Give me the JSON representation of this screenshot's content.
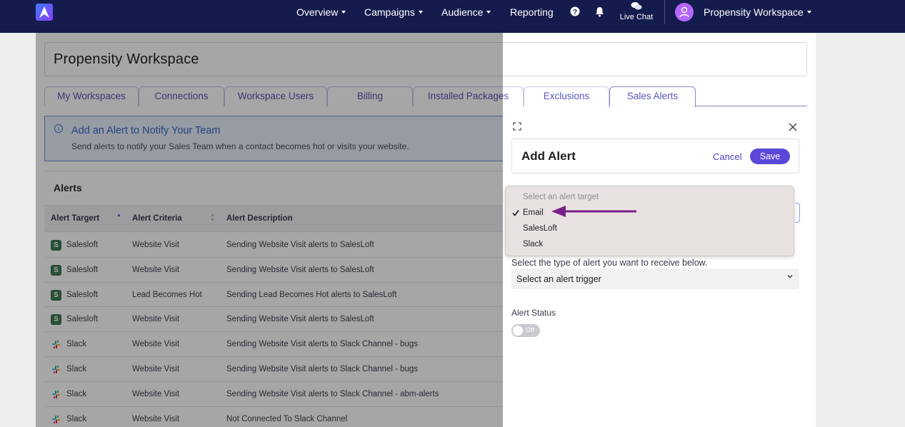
{
  "topnav": {
    "items": [
      {
        "label": "Overview"
      },
      {
        "label": "Campaigns"
      },
      {
        "label": "Audience"
      },
      {
        "label": "Reporting"
      }
    ],
    "live_chat": "Live Chat",
    "workspace": "Propensity Workspace"
  },
  "page": {
    "title": "Propensity Workspace",
    "tabs": [
      {
        "label": "My Workspaces"
      },
      {
        "label": "Connections"
      },
      {
        "label": "Workspace Users"
      },
      {
        "label": "Billing"
      },
      {
        "label": "Installed Packages"
      },
      {
        "label": "Exclusions"
      },
      {
        "label": "Sales Alerts"
      }
    ]
  },
  "info": {
    "title": "Add an Alert to Notify Your Team",
    "text": "Send alerts to notify your Sales Team when a contact becomes hot or visits your website."
  },
  "alerts": {
    "title": "Alerts",
    "columns": [
      "Alert Targert",
      "Alert Criteria",
      "Alert Description"
    ],
    "rows": [
      {
        "target": "Salesloft",
        "criteria": "Website Visit",
        "description": "Sending Website Visit alerts to SalesLoft",
        "icon": "salesloft-icon"
      },
      {
        "target": "Salesloft",
        "criteria": "Website Visit",
        "description": "Sending Website Visit alerts to SalesLoft",
        "icon": "salesloft-icon"
      },
      {
        "target": "Salesloft",
        "criteria": "Lead Becomes Hot",
        "description": "Sending Lead Becomes Hot alerts to SalesLoft",
        "icon": "salesloft-icon"
      },
      {
        "target": "Salesloft",
        "criteria": "Website Visit",
        "description": "Sending Website Visit alerts to SalesLoft",
        "icon": "salesloft-icon"
      },
      {
        "target": "Slack",
        "criteria": "Website Visit",
        "description": "Sending Website Visit alerts to Slack Channel - bugs",
        "icon": "slack-icon"
      },
      {
        "target": "Slack",
        "criteria": "Website Visit",
        "description": "Sending Website Visit alerts to Slack Channel - bugs",
        "icon": "slack-icon"
      },
      {
        "target": "Slack",
        "criteria": "Website Visit",
        "description": "Sending Website Visit alerts to Slack Channel - abm-alerts",
        "icon": "slack-icon"
      },
      {
        "target": "Slack",
        "criteria": "Website Visit",
        "description": "Not Connected To Slack Channel",
        "icon": "slack-icon"
      }
    ]
  },
  "drawer": {
    "title": "Add Alert",
    "cancel_label": "Cancel",
    "save_label": "Save",
    "target_menu": {
      "placeholder": "Select an alert target",
      "options": [
        "Email",
        "SalesLoft",
        "Slack"
      ],
      "selected": "Email"
    },
    "trigger_label": "Select the type of alert you want to receive below.",
    "trigger_placeholder": "Select an alert trigger",
    "status_label": "Alert Status",
    "status_toggle": "Off"
  },
  "colors": {
    "nav_bg": "#141b4d",
    "accent": "#5b47d9",
    "annotation_arrow": "#7a1f8a"
  }
}
